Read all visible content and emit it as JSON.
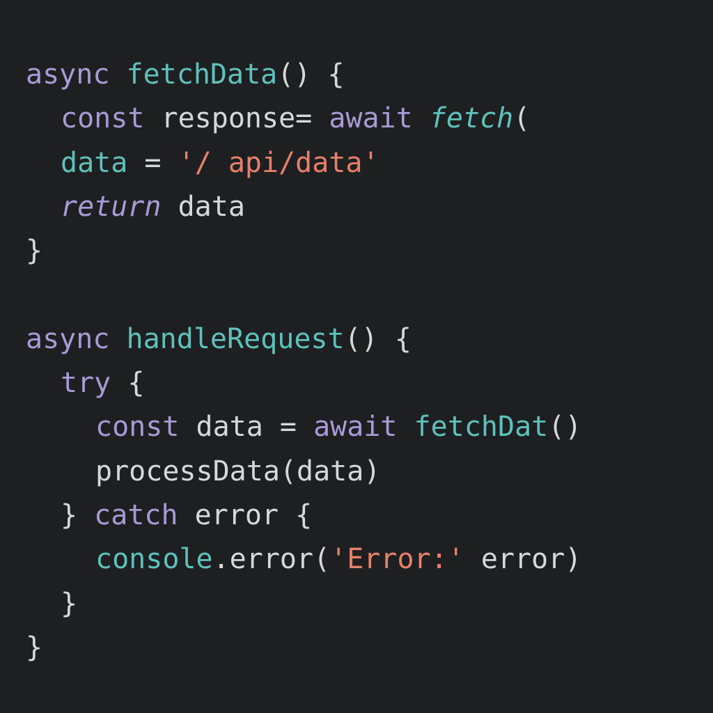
{
  "colors": {
    "background": "#1e1f21",
    "keyword": "#a99ad6",
    "function": "#5ec2bb",
    "string": "#e8806a",
    "text": "#d7d9d8"
  },
  "code": {
    "lines": [
      [
        {
          "t": "async",
          "c": "kw"
        },
        {
          "t": " ",
          "c": "txt"
        },
        {
          "t": "fetchData",
          "c": "fn"
        },
        {
          "t": "() {",
          "c": "pun"
        }
      ],
      [
        {
          "t": "const",
          "c": "kw"
        },
        {
          "t": " response= ",
          "c": "txt"
        },
        {
          "t": "await",
          "c": "kw"
        },
        {
          "t": " ",
          "c": "txt"
        },
        {
          "t": "fetch",
          "c": "fn-it"
        },
        {
          "t": "(",
          "c": "pun"
        }
      ],
      [
        {
          "t": "data",
          "c": "var"
        },
        {
          "t": " = ",
          "c": "txt"
        },
        {
          "t": "'/ api/data'",
          "c": "str"
        }
      ],
      [
        {
          "t": "return",
          "c": "kw-it"
        },
        {
          "t": " data",
          "c": "txt"
        }
      ],
      [
        {
          "t": "}",
          "c": "pun"
        }
      ],
      [
        {
          "t": "async",
          "c": "kw"
        },
        {
          "t": " ",
          "c": "txt"
        },
        {
          "t": "handleRequest",
          "c": "fn"
        },
        {
          "t": "() {",
          "c": "pun"
        }
      ],
      [
        {
          "t": "try",
          "c": "kw"
        },
        {
          "t": " {",
          "c": "pun"
        }
      ],
      [
        {
          "t": "const",
          "c": "kw"
        },
        {
          "t": " data = ",
          "c": "txt"
        },
        {
          "t": "await",
          "c": "kw"
        },
        {
          "t": " ",
          "c": "txt"
        },
        {
          "t": "fetchDat",
          "c": "fn"
        },
        {
          "t": "()",
          "c": "pun"
        }
      ],
      [
        {
          "t": "processData(data)",
          "c": "txt"
        }
      ],
      [
        {
          "t": "} ",
          "c": "pun"
        },
        {
          "t": "catch",
          "c": "kw"
        },
        {
          "t": " error {",
          "c": "txt"
        }
      ],
      [
        {
          "t": "console",
          "c": "fn"
        },
        {
          "t": ".error(",
          "c": "txt"
        },
        {
          "t": "'Error:'",
          "c": "str"
        },
        {
          "t": " error)",
          "c": "txt"
        }
      ],
      [
        {
          "t": "}",
          "c": "pun"
        }
      ],
      [
        {
          "t": "}",
          "c": "pun"
        }
      ]
    ]
  }
}
